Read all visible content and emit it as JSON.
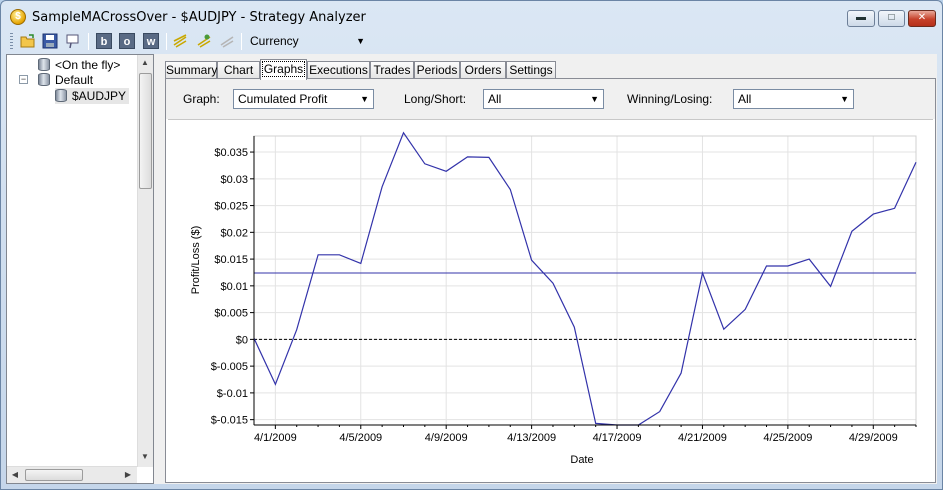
{
  "window": {
    "title": "SampleMACrossOver - $AUDJPY - Strategy Analyzer",
    "app_icon": "$",
    "controls": {
      "minimize": "▬",
      "maximize": "□",
      "close": "✕"
    }
  },
  "toolbar": {
    "currency_value": "Currency",
    "buttons": [
      "open-folder-icon",
      "save-icon",
      "pin-icon",
      "b",
      "o",
      "w",
      "optimize-icon",
      "backtest-icon",
      "walkforward-icon"
    ]
  },
  "tree": {
    "items": [
      {
        "label": "<On the fly>",
        "icon": "database-icon"
      },
      {
        "label": "Default",
        "icon": "database-icon",
        "expander": "−"
      },
      {
        "label": "$AUDJPY",
        "icon": "database-icon"
      }
    ]
  },
  "tabs": [
    "Summary",
    "Chart",
    "Graphs",
    "Executions",
    "Trades",
    "Periods",
    "Orders",
    "Settings"
  ],
  "active_tab": "Graphs",
  "filters": {
    "graph_label": "Graph:",
    "graph_value": "Cumulated Profit",
    "long_short_label": "Long/Short:",
    "long_short_value": "All",
    "winning_losing_label": "Winning/Losing:",
    "winning_losing_value": "All"
  },
  "chart_data": {
    "type": "line",
    "xlabel": "Date",
    "ylabel": "Profit/Loss ($)",
    "x_tick_labels": [
      "4/1/2009",
      "4/5/2009",
      "4/9/2009",
      "4/13/2009",
      "4/17/2009",
      "4/21/2009",
      "4/25/2009",
      "4/29/2009"
    ],
    "y_tick_labels": [
      "$-0.015",
      "$-0.01",
      "$-0.005",
      "$0",
      "$0.005",
      "$0.01",
      "$0.015",
      "$0.02",
      "$0.025",
      "$0.03",
      "$0.035"
    ],
    "ylim": [
      -0.016,
      0.038
    ],
    "xlim": [
      -1,
      30
    ],
    "grid": true,
    "reference_lines": [
      {
        "y": 0,
        "style": "dashed"
      },
      {
        "y": 0.0124,
        "style": "solid"
      }
    ],
    "line_color": "#3333aa",
    "series": [
      {
        "x": [
          -1,
          0,
          1,
          2,
          3,
          4,
          5,
          6,
          7,
          8,
          9,
          10,
          11,
          12,
          13,
          14,
          15,
          16,
          17,
          18,
          19,
          20,
          21,
          22,
          23,
          24,
          25,
          26,
          27,
          28,
          29,
          30
        ],
        "values": [
          0.0002,
          -0.0084,
          0.0018,
          0.0158,
          0.0158,
          0.0142,
          0.0285,
          0.0386,
          0.0328,
          0.0314,
          0.0341,
          0.034,
          0.028,
          0.0148,
          0.0105,
          0.0023,
          -0.0157,
          -0.016,
          -0.016,
          -0.0135,
          -0.0063,
          0.0124,
          0.0019,
          0.0056,
          0.0137,
          0.0137,
          0.015,
          0.0099,
          0.0202,
          0.0234,
          0.0245,
          0.0331
        ]
      }
    ]
  }
}
